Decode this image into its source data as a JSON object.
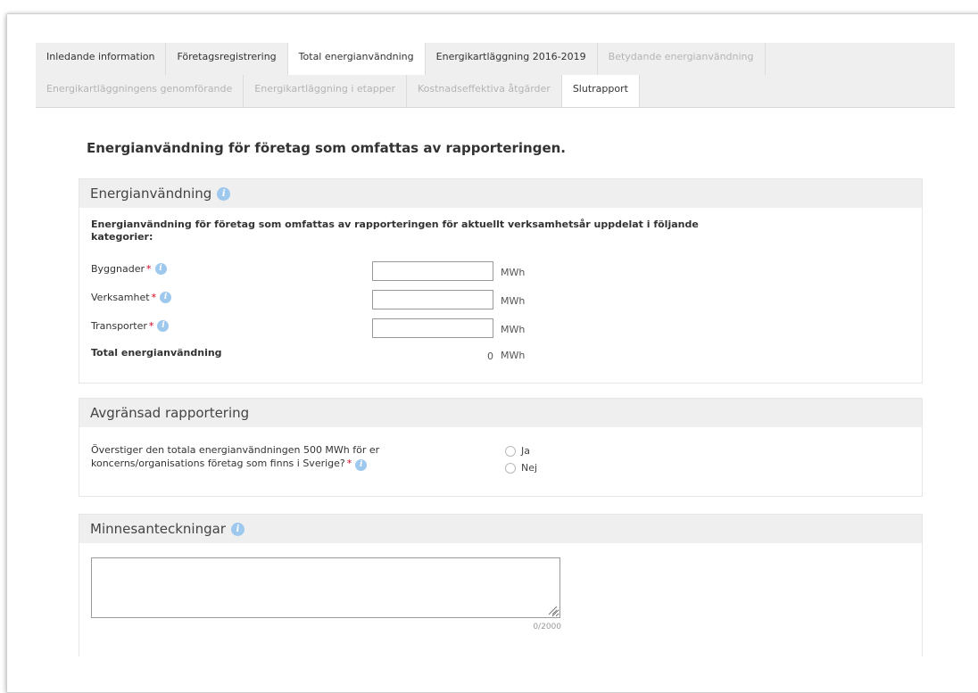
{
  "tabs": {
    "row1": [
      {
        "label": "Inledande information",
        "state": "normal"
      },
      {
        "label": "Företagsregistrering",
        "state": "normal"
      },
      {
        "label": "Total energianvändning",
        "state": "active"
      },
      {
        "label": "Energikartläggning 2016-2019",
        "state": "normal"
      },
      {
        "label": "Betydande energianvändning",
        "state": "disabled"
      }
    ],
    "row2": [
      {
        "label": "Energikartläggningens genomförande",
        "state": "disabled"
      },
      {
        "label": "Energikartläggning i etapper",
        "state": "disabled"
      },
      {
        "label": "Kostnadseffektiva åtgärder",
        "state": "disabled"
      },
      {
        "label": "Slutrapport",
        "state": "plain"
      }
    ]
  },
  "page": {
    "title": "Energianvändning för företag som omfattas av rapporteringen."
  },
  "energy": {
    "title": "Energianvändning",
    "description": "Energianvändning för företag som omfattas av rapporteringen för aktuellt verksamhetsår uppdelat i följande kategorier:",
    "fields": [
      {
        "label": "Byggnader",
        "value": "",
        "unit": "MWh"
      },
      {
        "label": "Verksamhet",
        "value": "",
        "unit": "MWh"
      },
      {
        "label": "Transporter",
        "value": "",
        "unit": "MWh"
      }
    ],
    "total": {
      "label": "Total energianvändning",
      "value": "0",
      "unit": "MWh"
    }
  },
  "limited": {
    "title": "Avgränsad rapportering",
    "question": "Överstiger den totala energianvändningen 500 MWh för er koncerns/organisations företag som finns i Sverige?",
    "options": [
      "Ja",
      "Nej"
    ]
  },
  "notes": {
    "title": "Minnesanteckningar",
    "value": "",
    "counter": "0/2000"
  },
  "colors": {
    "info_icon": "#9fc8ee",
    "required": "#d0021b",
    "section_header": "#efefef"
  },
  "icons": {
    "info": "info-icon",
    "resize": "resize-grip-icon"
  },
  "required_mark": "*",
  "info_glyph": "i"
}
